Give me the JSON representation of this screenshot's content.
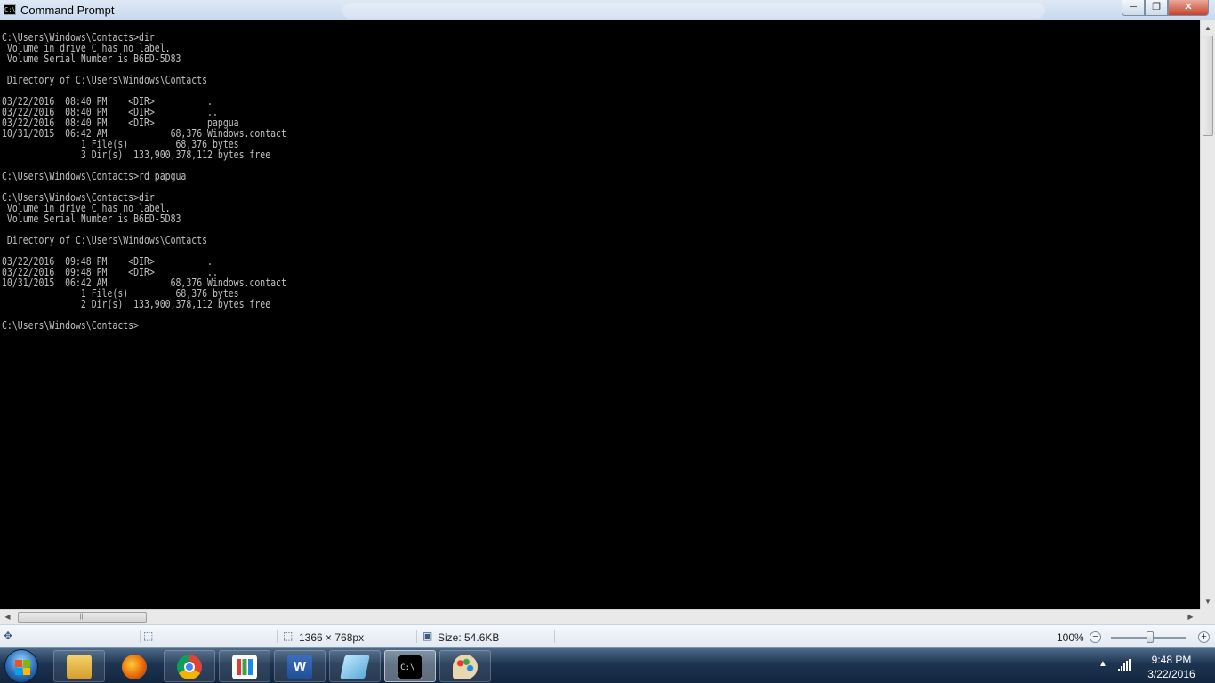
{
  "window": {
    "title": "Command Prompt",
    "icon_text": "C:\\_"
  },
  "console": {
    "lines": [
      "C:\\Users\\Windows\\Contacts>dir",
      " Volume in drive C has no label.",
      " Volume Serial Number is B6ED-5D83",
      "",
      " Directory of C:\\Users\\Windows\\Contacts",
      "",
      "03/22/2016  08:40 PM    <DIR>          .",
      "03/22/2016  08:40 PM    <DIR>          ..",
      "03/22/2016  08:40 PM    <DIR>          papgua",
      "10/31/2015  06:42 AM            68,376 Windows.contact",
      "               1 File(s)         68,376 bytes",
      "               3 Dir(s)  133,900,378,112 bytes free",
      "",
      "C:\\Users\\Windows\\Contacts>rd papgua",
      "",
      "C:\\Users\\Windows\\Contacts>dir",
      " Volume in drive C has no label.",
      " Volume Serial Number is B6ED-5D83",
      "",
      " Directory of C:\\Users\\Windows\\Contacts",
      "",
      "03/22/2016  09:48 PM    <DIR>          .",
      "03/22/2016  09:48 PM    <DIR>          ..",
      "10/31/2015  06:42 AM            68,376 Windows.contact",
      "               1 File(s)         68,376 bytes",
      "               2 Dir(s)  133,900,378,112 bytes free",
      "",
      "C:\\Users\\Windows\\Contacts>"
    ],
    "text_color": "#c0c0c0",
    "background": "#000000"
  },
  "statusbar": {
    "dimensions": "1366 × 768px",
    "size": "Size: 54.6KB",
    "zoom": "100%",
    "zoom_level_percent": 100
  },
  "taskbar": {
    "apps": [
      {
        "name": "file-explorer-icon",
        "glyph": "📁"
      },
      {
        "name": "firefox-icon",
        "glyph": ""
      },
      {
        "name": "chrome-icon",
        "glyph": ""
      },
      {
        "name": "apps-grid-icon",
        "glyph": ""
      },
      {
        "name": "word-icon",
        "glyph": "W"
      },
      {
        "name": "notepad-icon",
        "glyph": ""
      },
      {
        "name": "command-prompt-icon",
        "glyph": "C:\\_"
      },
      {
        "name": "paint-icon",
        "glyph": ""
      }
    ],
    "time": "9:48 PM",
    "date": "3/22/2016",
    "colors": {
      "file_explorer": "#e8b84a",
      "firefox": "#e66000",
      "chrome": "#4285f4",
      "word": "#2b579a",
      "cmd": "#000000"
    }
  }
}
